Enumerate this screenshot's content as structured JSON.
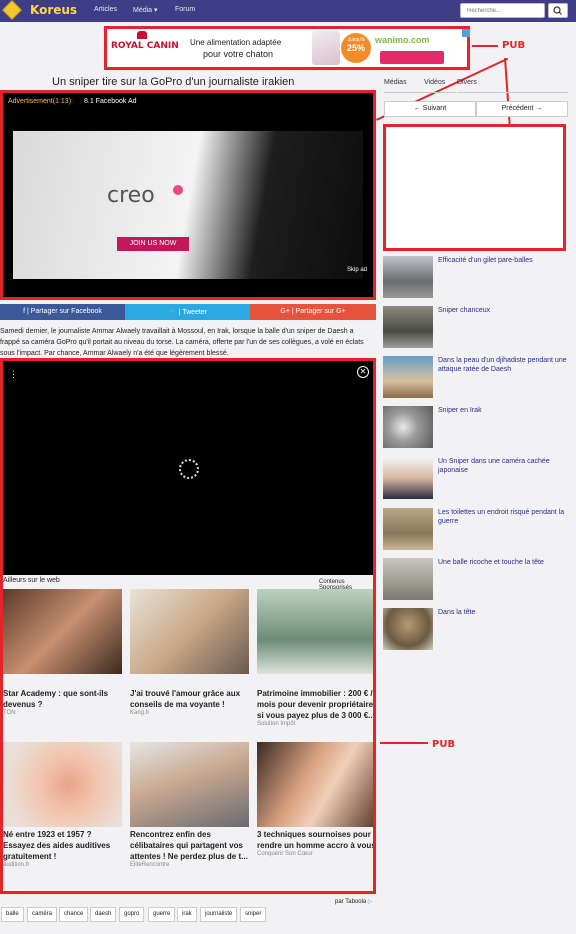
{
  "nav": {
    "logo_text": "Koreus",
    "links": [
      "Articles",
      "Média ▾",
      "Forum"
    ],
    "search_placeholder": "Recherche..."
  },
  "banner_ad": {
    "brand": "ROYAL CANIN",
    "line1": "Une alimentation adaptée",
    "line2": "pour votre chaton",
    "badge": "25%",
    "badge_small": "Jusqu'à",
    "partner": "wanimo.com"
  },
  "annotations": {
    "pub_top": "PUB",
    "pub_bottom": "PUB",
    "color": "#e4232a"
  },
  "article": {
    "title": "Un sniper tire sur la GoPro d'un journaliste irakien",
    "ad_label": "Advertisement(1:13):",
    "ad_title": "8.1 Facebook Ad",
    "video_brand": "creo",
    "video_button": "JOIN US NOW",
    "skip": "Skip ad",
    "share": {
      "facebook": "f | Partager sur Facebook",
      "twitter": "🐦 | Tweeter",
      "google": "G+ | Partager sur G+"
    },
    "text": "Samedi dernier, le journaliste Ammar Alwaely travaillait à Mossoul, en Irak, lorsque la balle d'un sniper de Daesh a frappé sa caméra GoPro qu'il portait au niveau du torse. La caméra, offerte par l'un de ses collègues, a volé en éclats sous l'impact. Par chance, Ammar Alwaely n'a été que légèrement blessé."
  },
  "sponsored": {
    "heading": "Ailleurs sur le web",
    "sponsor_label": "Contenus Sponsorisés",
    "taboola": "par Taboola",
    "tiles": [
      {
        "title": "Star Academy : que sont-ils devenus ?",
        "source": "TON"
      },
      {
        "title": "J'ai trouvé l'amour grâce aux conseils de ma voyante !",
        "source": "Kang.fr"
      },
      {
        "title": "Patrimoine immobilier : 200 € / mois pour devenir propriétaire si vous payez plus de 3 000 €...",
        "source": "Solution Impôt"
      },
      {
        "title": "Né entre 1923 et 1957 ? Essayez des aides auditives gratuitement !",
        "source": "audition.fr"
      },
      {
        "title": "Rencontrez enfin des célibataires qui partagent vos attentes ! Ne perdez plus de t...",
        "source": "EliteRencontre"
      },
      {
        "title": "3 techniques sournoises pour rendre un homme accro à vous",
        "source": "Conquérir Son Cœur"
      }
    ]
  },
  "sidebar": {
    "tabs": [
      "Médias",
      "Vidéos",
      "Divers"
    ],
    "prev": "← Suivant",
    "next": "Précédent →",
    "related": [
      "Efficacité d'un gilet pare-balles",
      "Sniper chanceux",
      "Dans la peau d'un djihadiste pendant une attaque ratée de Daesh",
      "Sniper en Irak",
      "Un Sniper dans une caméra cachée japonaise",
      "Les toilettes un endroit risqué pendant la guerre",
      "Une balle ricoche et touche la tête",
      "Dans la tête"
    ]
  },
  "tags": [
    "balle",
    "caméra",
    "chance",
    "daesh",
    "gopro",
    "guerre",
    "irak",
    "journaliste",
    "sniper"
  ]
}
